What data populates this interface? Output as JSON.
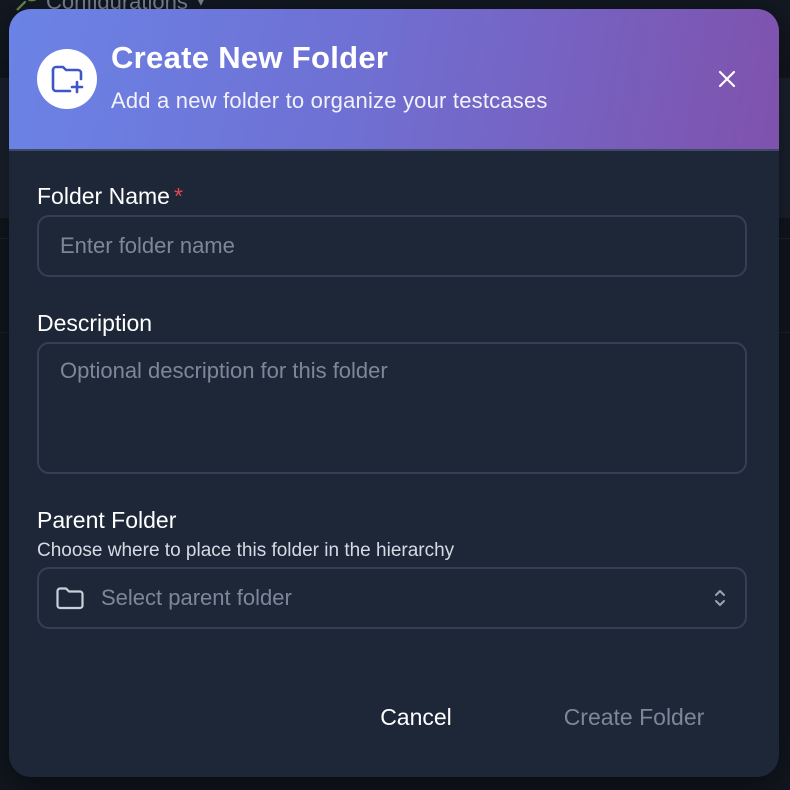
{
  "background": {
    "nav_label": "Configurations"
  },
  "modal": {
    "title": "Create New Folder",
    "subtitle": "Add a new folder to organize your testcases",
    "header_icon": "folder-plus-icon",
    "close_icon": "close-icon",
    "gradient_colors": [
      "#6b83e6",
      "#7f52ad"
    ]
  },
  "form": {
    "folder_name": {
      "label": "Folder Name",
      "required_marker": "*",
      "placeholder": "Enter folder name",
      "value": ""
    },
    "description": {
      "label": "Description",
      "placeholder": "Optional description for this folder",
      "value": ""
    },
    "parent_folder": {
      "label": "Parent Folder",
      "helper": "Choose where to place this folder in the hierarchy",
      "placeholder": "Select parent folder",
      "icon": "folder-icon",
      "chevron_icon": "chevron-up-down-icon"
    }
  },
  "actions": {
    "cancel_label": "Cancel",
    "create_label": "Create Folder"
  },
  "colors": {
    "modal_bg": "#1e2738",
    "border": "#344055",
    "required": "#e54848",
    "placeholder": "#7c8798"
  }
}
